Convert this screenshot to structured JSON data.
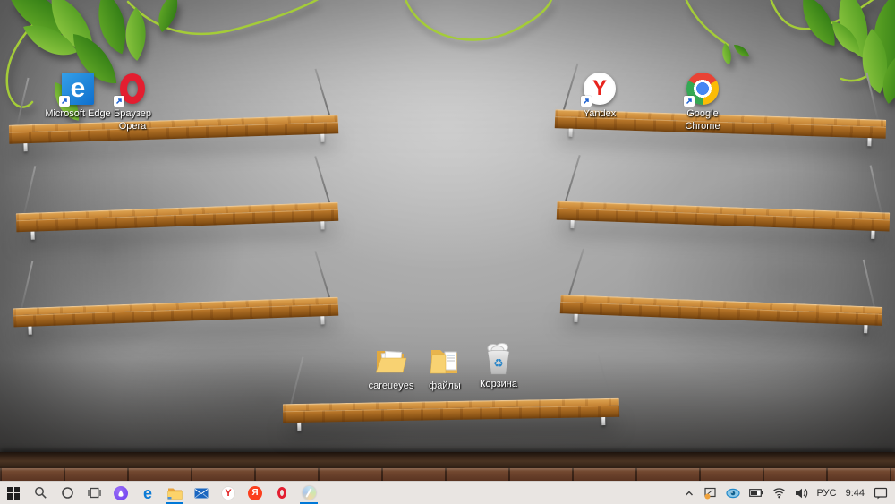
{
  "desktop": {
    "icons": [
      {
        "name": "microsoft-edge",
        "label": "Microsoft Edge",
        "shortcut": true
      },
      {
        "name": "opera-browser",
        "label": "Браузер Opera",
        "shortcut": true
      },
      {
        "name": "yandex",
        "label": "Yandex",
        "shortcut": true
      },
      {
        "name": "google-chrome",
        "label": "Google Chrome",
        "shortcut": true
      },
      {
        "name": "careueyes-folder",
        "label": "careueyes",
        "shortcut": false
      },
      {
        "name": "files-folder",
        "label": "файлы",
        "shortcut": false
      },
      {
        "name": "recycle-bin",
        "label": "Корзина",
        "shortcut": false
      }
    ],
    "glyphs": {
      "edge": "e",
      "yandex": "Y"
    }
  },
  "taskbar": {
    "items": [
      "start",
      "search",
      "cortana",
      "task-view",
      "alice-assistant",
      "edge",
      "file-explorer",
      "mail",
      "yandex-browser",
      "yandex",
      "opera",
      "careueyes"
    ],
    "running": [
      "file-explorer",
      "careueyes"
    ],
    "glyphs": {
      "edge": "e",
      "yandex_browser": "Y",
      "yandex": "Я"
    },
    "tray": {
      "language": "РУС",
      "time": "9:44",
      "icons": [
        "hidden-icons-chevron",
        "projector-notification",
        "careueyes-eye",
        "battery",
        "wifi",
        "volume",
        "action-center"
      ]
    }
  },
  "colors": {
    "accent": "#0078d7",
    "taskbar_bg": "#e9e5e2",
    "shelf_wood": "#c68434",
    "wall": "#949494",
    "vine_green": "#a4cc38",
    "opera_red": "#e31e30",
    "yandex_red": "#fc3f1d",
    "edge_blue": "#1183d6"
  }
}
